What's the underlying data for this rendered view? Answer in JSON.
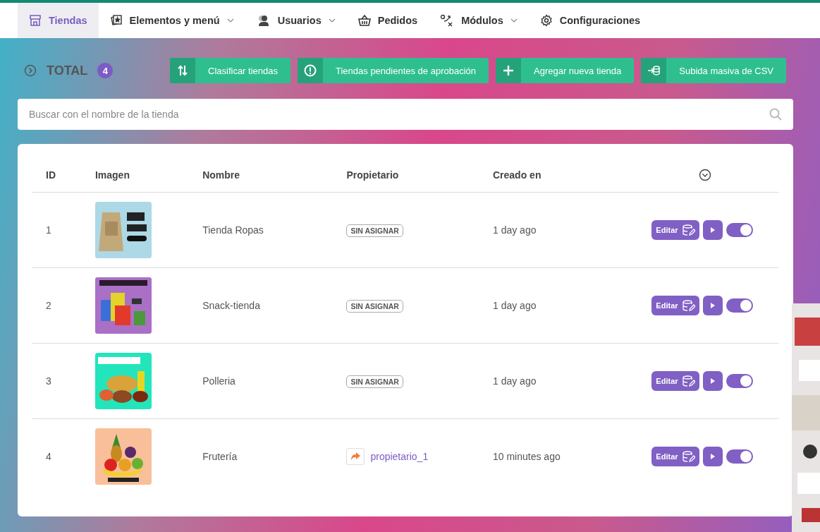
{
  "nav": [
    {
      "label": "Tiendas",
      "dropdown": false,
      "selected": true
    },
    {
      "label": "Elementos y menú",
      "dropdown": true,
      "selected": false
    },
    {
      "label": "Usuarios",
      "dropdown": true,
      "selected": false
    },
    {
      "label": "Pedidos",
      "dropdown": false,
      "selected": false
    },
    {
      "label": "Módulos",
      "dropdown": true,
      "selected": false
    },
    {
      "label": "Configuraciones",
      "dropdown": false,
      "selected": false
    }
  ],
  "total": {
    "label": "TOTAL",
    "count": "4"
  },
  "actions": [
    {
      "label": "Clasificar tiendas"
    },
    {
      "label": "Tiendas pendientes de aprobación"
    },
    {
      "label": "Agregar nueva tienda"
    },
    {
      "label": "Subida masiva de CSV"
    }
  ],
  "search": {
    "placeholder": "Buscar con el nombre de la tienda"
  },
  "table": {
    "columns": [
      "ID",
      "Imagen",
      "Nombre",
      "Propietario",
      "Creado en"
    ],
    "rows": [
      {
        "id": "1",
        "name": "Tienda Ropas",
        "owner": {
          "kind": "badge",
          "text": "SIN ASIGNAR"
        },
        "created": "1 day ago",
        "edit": "Editar",
        "on": true
      },
      {
        "id": "2",
        "name": "Snack-tienda",
        "owner": {
          "kind": "badge",
          "text": "SIN ASIGNAR"
        },
        "created": "1 day ago",
        "edit": "Editar",
        "on": true
      },
      {
        "id": "3",
        "name": "Polleria",
        "owner": {
          "kind": "badge",
          "text": "SIN ASIGNAR"
        },
        "created": "1 day ago",
        "edit": "Editar",
        "on": true
      },
      {
        "id": "4",
        "name": "Frutería",
        "owner": {
          "kind": "link",
          "text": "propietario_1"
        },
        "created": "10 minutes ago",
        "edit": "Editar",
        "on": true
      }
    ]
  }
}
